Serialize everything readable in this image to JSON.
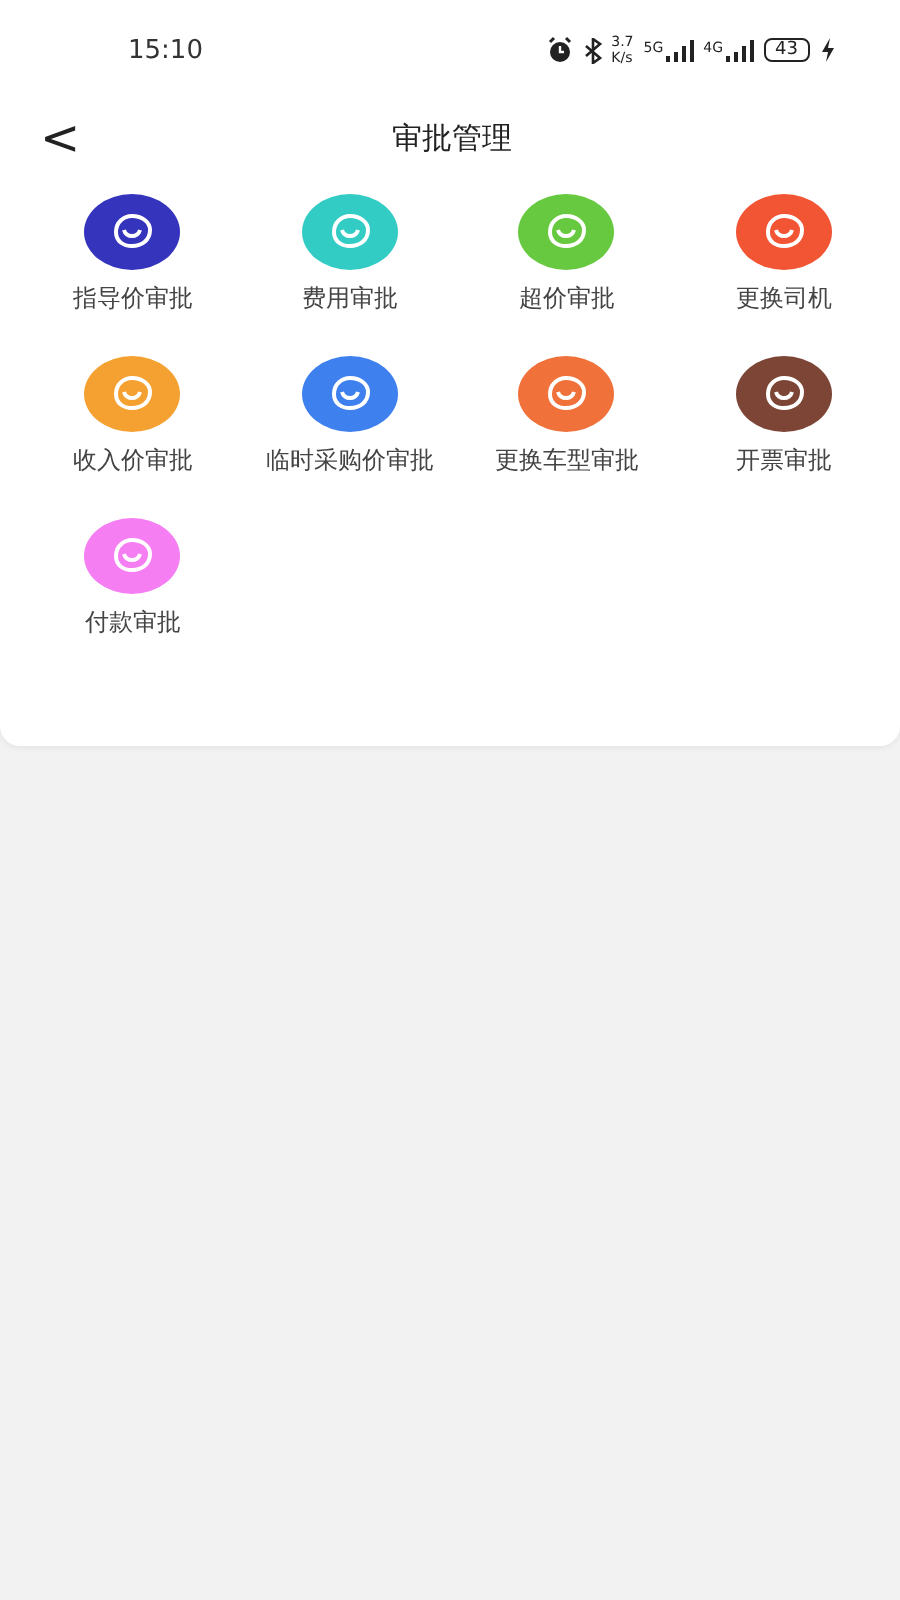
{
  "status_bar": {
    "time": "15:10",
    "speed_value": "3.7",
    "speed_unit": "K/s",
    "network_1": "5G",
    "network_2": "4G",
    "battery": "43"
  },
  "header": {
    "back": "<",
    "title": "审批管理"
  },
  "approvals": [
    {
      "label": "指导价审批",
      "color": "#3434bc"
    },
    {
      "label": "费用审批",
      "color": "#33ccc4"
    },
    {
      "label": "超价审批",
      "color": "#66c93f"
    },
    {
      "label": "更换司机",
      "color": "#f25534"
    },
    {
      "label": "收入价审批",
      "color": "#f5a132"
    },
    {
      "label": "临时采购价审批",
      "color": "#3e80ee"
    },
    {
      "label": "更换车型审批",
      "color": "#f0713a"
    },
    {
      "label": "开票审批",
      "color": "#7c4536"
    },
    {
      "label": "付款审批",
      "color": "#f47ef2"
    }
  ]
}
